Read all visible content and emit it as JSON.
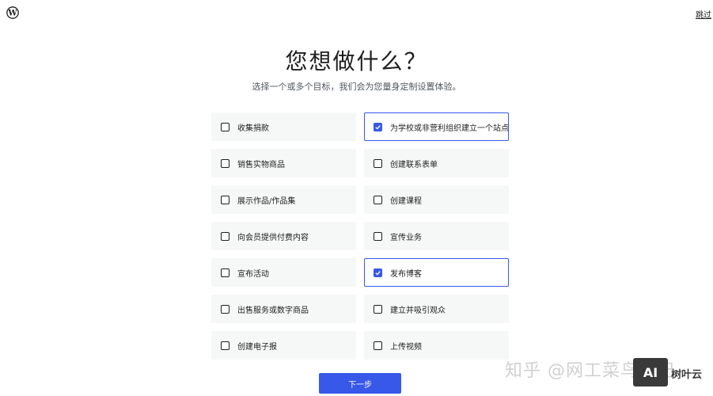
{
  "header": {
    "logo_icon": "wordpress-logo-icon",
    "skip_label": "跳过"
  },
  "main": {
    "title": "您想做什么？",
    "subtitle": "选择一个或多个目标，我们会为您量身定制设置体验。",
    "options": [
      {
        "label": "收集捐款",
        "checked": false
      },
      {
        "label": "为学校或非营利组织建立一个站点",
        "checked": true
      },
      {
        "label": "销售实物商品",
        "checked": false
      },
      {
        "label": "创建联系表单",
        "checked": false
      },
      {
        "label": "展示作品/作品集",
        "checked": false
      },
      {
        "label": "创建课程",
        "checked": false
      },
      {
        "label": "向会员提供付费内容",
        "checked": false
      },
      {
        "label": "宣传业务",
        "checked": false
      },
      {
        "label": "宣布活动",
        "checked": false
      },
      {
        "label": "发布博客",
        "checked": true
      },
      {
        "label": "出售服务或数字商品",
        "checked": false
      },
      {
        "label": "建立并吸引观众",
        "checked": false
      },
      {
        "label": "创建电子报",
        "checked": false
      },
      {
        "label": "上传视频",
        "checked": false
      }
    ],
    "next_label": "下一步"
  },
  "watermark": {
    "zhihu_text": "知乎 @网工菜鸟日记",
    "badge_text": "AI",
    "brand_text": "树叶云"
  },
  "colors": {
    "accent": "#3858e9",
    "option_bg": "#f6f7f7",
    "text": "#1e1e1e",
    "muted": "#50575e"
  }
}
